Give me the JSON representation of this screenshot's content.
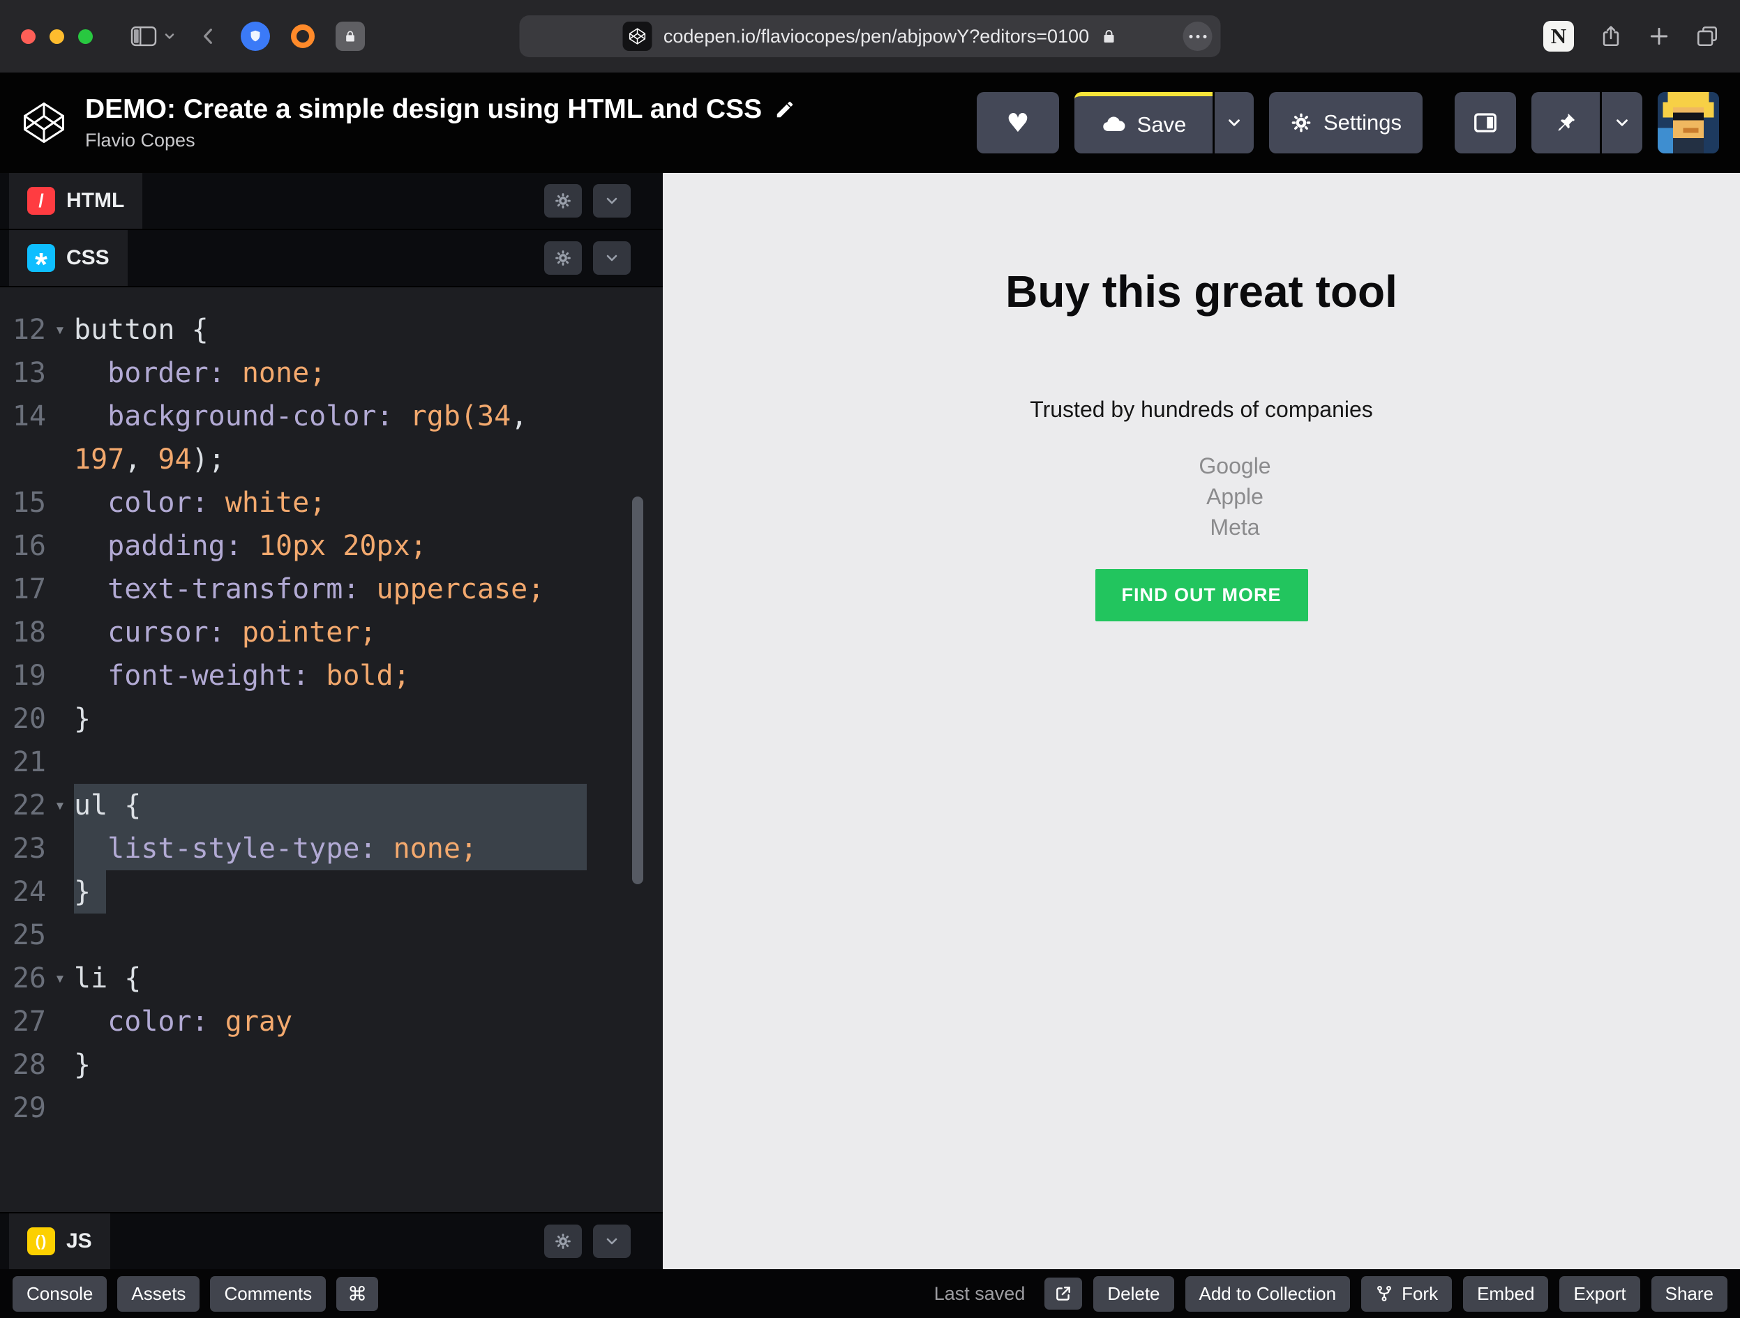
{
  "colors": {
    "cta_green": "#22c55e",
    "save_accent": "#f7e53a",
    "html_icon": "#ff3c41",
    "css_icon": "#0ebeff",
    "js_icon": "#fcd000",
    "code_property": "#b2aad4",
    "code_value": "#f3a96e",
    "preview_background": "#ebebed"
  },
  "browser": {
    "url": "codepen.io/flaviocopes/pen/abjpowY?editors=0100",
    "notion_label": "N"
  },
  "pen": {
    "title": "DEMO: Create a simple design using HTML and CSS",
    "author": "Flavio Copes"
  },
  "header": {
    "save_label": "Save",
    "settings_label": "Settings",
    "heart_glyph": "♥"
  },
  "editor": {
    "html_label": "HTML",
    "css_label": "CSS",
    "js_label": "JS",
    "html_icon_glyph": "/",
    "css_icon_glyph": "*",
    "js_icon_glyph": "()",
    "fold_icon": "▾",
    "css_lines": [
      {
        "n": "12",
        "fold": true,
        "t": [
          [
            "sel",
            "button"
          ],
          [
            "pln",
            " {"
          ]
        ]
      },
      {
        "n": "13",
        "t": [
          [
            "pln",
            "  "
          ],
          [
            "prop",
            "border:"
          ],
          [
            "pln",
            " "
          ],
          [
            "val",
            "none;"
          ]
        ]
      },
      {
        "n": "14",
        "t": [
          [
            "pln",
            "  "
          ],
          [
            "prop",
            "background-color:"
          ],
          [
            "pln",
            " "
          ],
          [
            "val",
            "rgb("
          ],
          [
            "num",
            "34"
          ],
          [
            "pln",
            ","
          ]
        ]
      },
      {
        "n": "",
        "t": [
          [
            "num",
            "197"
          ],
          [
            "pln",
            ", "
          ],
          [
            "num",
            "94"
          ],
          [
            "pln",
            ");"
          ]
        ]
      },
      {
        "n": "15",
        "t": [
          [
            "pln",
            "  "
          ],
          [
            "prop",
            "color:"
          ],
          [
            "pln",
            " "
          ],
          [
            "val",
            "white;"
          ]
        ]
      },
      {
        "n": "16",
        "t": [
          [
            "pln",
            "  "
          ],
          [
            "prop",
            "padding:"
          ],
          [
            "pln",
            " "
          ],
          [
            "val",
            "10px 20px;"
          ]
        ]
      },
      {
        "n": "17",
        "t": [
          [
            "pln",
            "  "
          ],
          [
            "prop",
            "text-transform:"
          ],
          [
            "pln",
            " "
          ],
          [
            "val",
            "uppercase;"
          ]
        ]
      },
      {
        "n": "18",
        "t": [
          [
            "pln",
            "  "
          ],
          [
            "prop",
            "cursor:"
          ],
          [
            "pln",
            " "
          ],
          [
            "val",
            "pointer;"
          ]
        ]
      },
      {
        "n": "19",
        "t": [
          [
            "pln",
            "  "
          ],
          [
            "prop",
            "font-weight:"
          ],
          [
            "pln",
            " "
          ],
          [
            "val",
            "bold;"
          ]
        ]
      },
      {
        "n": "20",
        "t": [
          [
            "pln",
            "}"
          ]
        ]
      },
      {
        "n": "21",
        "t": []
      },
      {
        "n": "22",
        "fold": true,
        "selw": 735,
        "t": [
          [
            "sel",
            "ul"
          ],
          [
            "pln",
            " {"
          ]
        ]
      },
      {
        "n": "23",
        "selw": 735,
        "t": [
          [
            "pln",
            "  "
          ],
          [
            "prop",
            "list-style-type:"
          ],
          [
            "pln",
            " "
          ],
          [
            "val",
            "none;"
          ]
        ]
      },
      {
        "n": "24",
        "selw": 46,
        "t": [
          [
            "pln",
            "}"
          ]
        ]
      },
      {
        "n": "25",
        "t": []
      },
      {
        "n": "26",
        "fold": true,
        "t": [
          [
            "sel",
            "li"
          ],
          [
            "pln",
            " {"
          ]
        ]
      },
      {
        "n": "27",
        "t": [
          [
            "pln",
            "  "
          ],
          [
            "prop",
            "color:"
          ],
          [
            "pln",
            " "
          ],
          [
            "val",
            "gray"
          ]
        ]
      },
      {
        "n": "28",
        "t": [
          [
            "pln",
            "}"
          ]
        ]
      },
      {
        "n": "29",
        "t": []
      }
    ]
  },
  "preview": {
    "heading": "Buy this great tool",
    "tagline": "Trusted by hundreds of companies",
    "companies": [
      "Google",
      "Apple",
      "Meta"
    ],
    "cta_label": "FIND OUT MORE"
  },
  "footer": {
    "console": "Console",
    "assets": "Assets",
    "comments": "Comments",
    "cmd_glyph": "⌘",
    "last_saved": "Last saved",
    "delete": "Delete",
    "add_to_collection": "Add to Collection",
    "fork": "Fork",
    "embed": "Embed",
    "export": "Export",
    "share": "Share"
  }
}
